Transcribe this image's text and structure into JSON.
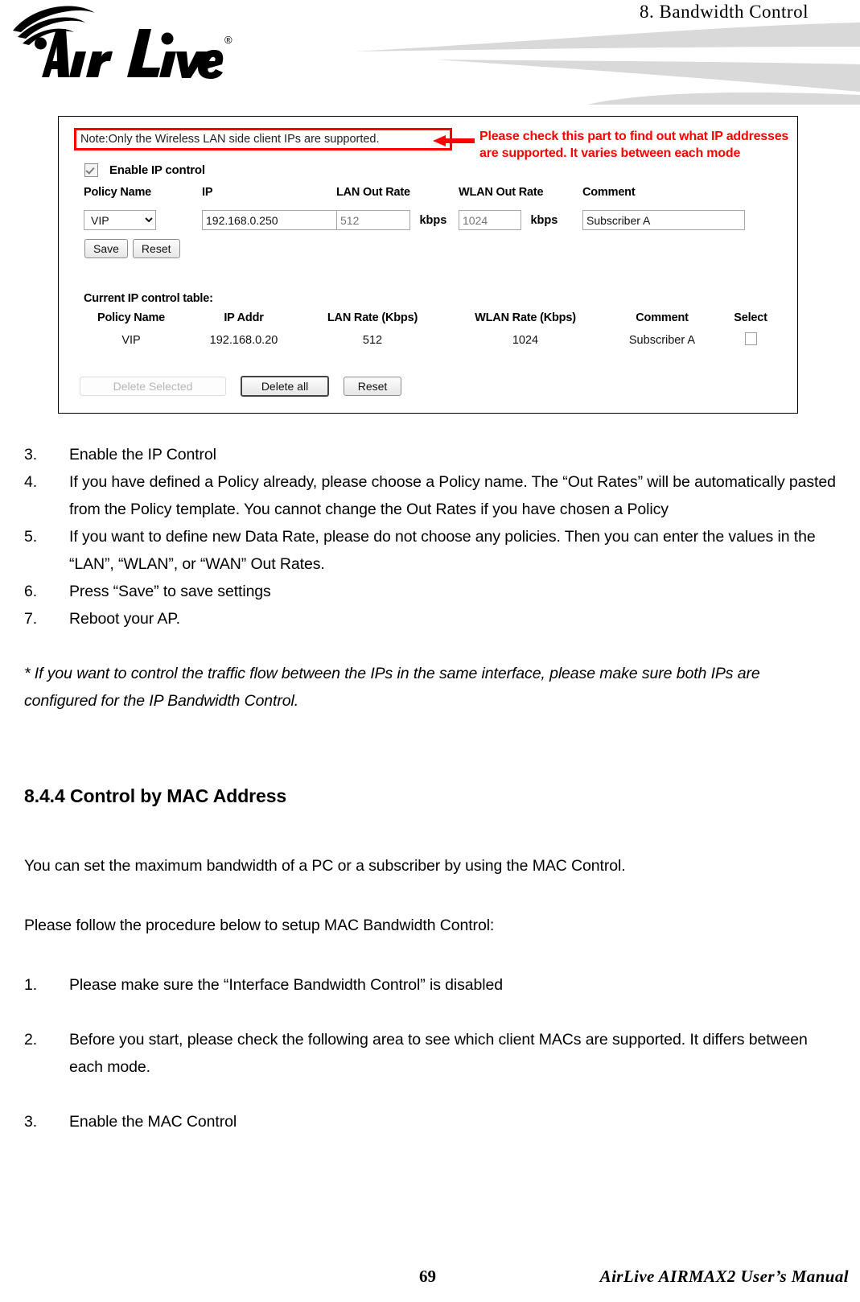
{
  "header": {
    "chapter_title": "8.  Bandwidth  Control",
    "logo_text": "Air Live",
    "logo_trademark": "®"
  },
  "figure": {
    "note": "Note:Only the Wireless LAN side client IPs are supported.",
    "enable_checkbox_label": "Enable IP control",
    "enable_checkbox_checked": true,
    "form_headers": {
      "policy_name": "Policy Name",
      "ip": "IP",
      "lan_out_rate": "LAN Out Rate",
      "wlan_out_rate": "WLAN Out Rate",
      "comment": "Comment"
    },
    "form_values": {
      "policy_name_selected": "VIP",
      "ip_value": "192.168.0.250",
      "lan_out_rate_placeholder": "512",
      "lan_units": "kbps",
      "wlan_out_rate_placeholder": "1024",
      "wlan_units": "kbps",
      "comment_value": "Subscriber A"
    },
    "form_buttons": {
      "save": "Save",
      "reset": "Reset"
    },
    "table_caption": "Current IP control table:",
    "table_headers": [
      "Policy Name",
      "IP Addr",
      "LAN Rate (Kbps)",
      "WLAN Rate (Kbps)",
      "Comment",
      "Select"
    ],
    "table_rows": [
      {
        "policy_name": "VIP",
        "ip_addr": "192.168.0.20",
        "lan_rate": "512",
        "wlan_rate": "1024",
        "comment": "Subscriber A",
        "selected": false
      }
    ],
    "table_buttons": {
      "delete_selected": "Delete Selected",
      "delete_selected_disabled": true,
      "delete_all": "Delete all",
      "reset": "Reset"
    }
  },
  "callout": {
    "line1": "Please check this part to find out what IP addresses",
    "line2": "are supported.   It varies between each mode",
    "color": "#ff0000"
  },
  "body": {
    "steps_ip": [
      {
        "num": "3.",
        "text": "Enable the IP Control"
      },
      {
        "num": "4.",
        "text": "If you have defined a Policy already, please choose a Policy name.    The “Out Rates” will be automatically pasted from the Policy template.    You cannot change the Out Rates if you have chosen a Policy"
      },
      {
        "num": "5.",
        "text": "If you want to define new Data Rate, please do not choose any policies.    Then you can enter the values in the “LAN”, “WLAN”, or “WAN” Out Rates."
      },
      {
        "num": "6.",
        "text": "Press “Save” to save settings"
      },
      {
        "num": "7.",
        "text": "Reboot your AP."
      }
    ],
    "note_paragraph": "* If you want to control the traffic flow between the IPs in the same interface, please make sure both IPs are configured for the IP Bandwidth Control.",
    "section_heading": "8.4.4 Control by MAC Address",
    "intro_paragraph": "You can set the maximum bandwidth of a PC or a subscriber by using the MAC Control.",
    "procedure_lead": "Please follow the procedure below to setup MAC Bandwidth Control:",
    "steps_mac": [
      {
        "num": "1.",
        "text": "Please make sure the “Interface Bandwidth Control” is disabled"
      },
      {
        "num": "2.",
        "text": "Before you start, please check the following area to see which client MACs are supported.    It differs between each mode."
      },
      {
        "num": "3.",
        "text": "Enable the MAC Control"
      }
    ]
  },
  "footer": {
    "page_number": "69",
    "manual_name": "AirLive  AIRMAX2  User’s  Manual"
  }
}
